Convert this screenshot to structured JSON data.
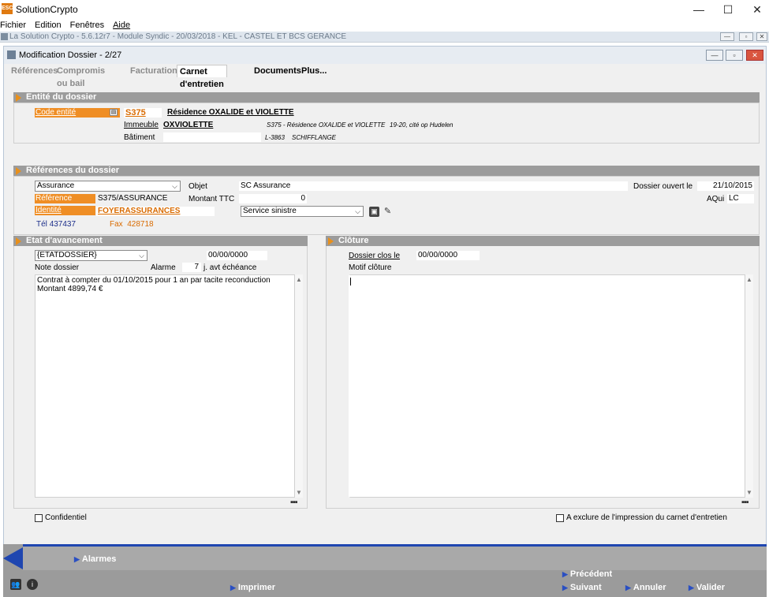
{
  "os": {
    "app_title": "SolutionCrypto",
    "logo_text": "ESC",
    "minimize": "—",
    "maximize": "☐",
    "close": "✕"
  },
  "menu": [
    "Fichier",
    "Edition",
    "Fenêtres",
    "Aide"
  ],
  "app_bar": {
    "title": "La Solution Crypto - 5.6.12r7 - Module Syndic - 20/03/2018 - KEL - CASTEL ET BCS GERANCE"
  },
  "window": {
    "title": "Modification Dossier - 2/27"
  },
  "tabs": [
    {
      "label": "Références"
    },
    {
      "label": "Compromis ou bail"
    },
    {
      "label": "Facturation"
    },
    {
      "label": "Carnet d'entretien"
    },
    {
      "label": "Documents"
    },
    {
      "label": "Plus..."
    }
  ],
  "entite": {
    "header": "Entité du dossier",
    "code_label": "Code entité",
    "code_value": "S375",
    "residence": "Résidence OXALIDE et VIOLETTE",
    "immeuble_label": "Immeuble",
    "immeuble_value": "OXVIOLETTE",
    "immeuble_detail": "S375 - Résidence OXALIDE et VIOLETTE",
    "address": "19-20, cité op Hudelen",
    "batiment_label": "Bâtiment",
    "batiment_value": "",
    "postal": "L-3863",
    "city": "SCHIFFLANGE"
  },
  "references": {
    "header": "Références du dossier",
    "type_select": "Assurance",
    "objet_label": "Objet",
    "objet_value": "SC Assurance",
    "ouvert_label": "Dossier ouvert le",
    "ouvert_value": "21/10/2015",
    "reference_label": "Référence",
    "reference_value": "S375/ASSURANCE",
    "montant_label": "Montant TTC",
    "montant_value": "0",
    "aqui_label": "AQui",
    "aqui_value": "LC",
    "identite_label": "Identité",
    "identite_value": "FOYERASSURANCES",
    "service_select": "Service sinistre",
    "tel_label": "Tél",
    "tel_value": "437437",
    "fax_label": "Fax",
    "fax_value": "428718"
  },
  "etat": {
    "header": "Etat d'avancement",
    "status_select": "{ETATDOSSIER}",
    "date_value": "00/00/0000",
    "note_label": "Note dossier",
    "alarme_label": "Alarme",
    "alarme_days": "7",
    "alarme_suffix": "j. avt échéance",
    "note_text": "Contrat à compter du 01/10/2015 pour 1 an par tacite reconduction\nMontant 4899,74 €"
  },
  "cloture": {
    "header": "Clôture",
    "clos_label": "Dossier clos le",
    "clos_value": "00/00/0000",
    "motif_label": "Motif clôture",
    "motif_text": ""
  },
  "options": {
    "confidentiel": "Confidentiel",
    "exclure": "A exclure de l'impression du carnet d'entretien"
  },
  "bottom": {
    "alarmes": "Alarmes",
    "imprimer": "Imprimer",
    "precedent": "Précédent",
    "suivant": "Suivant",
    "annuler": "Annuler",
    "valider": "Valider"
  }
}
